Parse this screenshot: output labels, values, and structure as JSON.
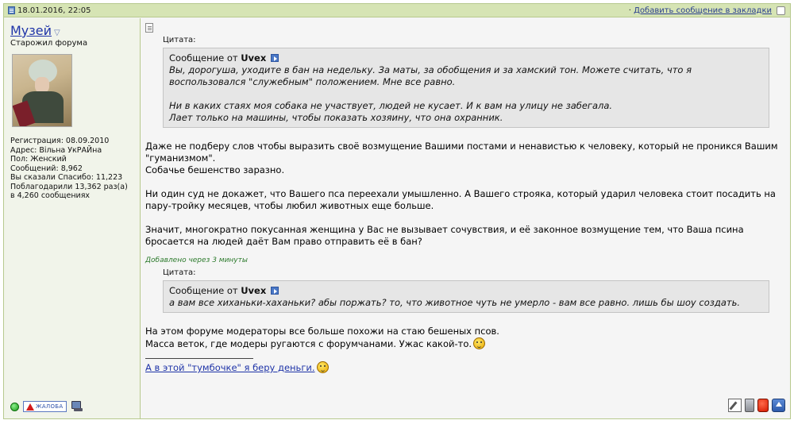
{
  "header": {
    "timestamp": "18.01.2016, 22:05",
    "bookmark_link": "Добавить сообщение в закладки",
    "bookmark_prefix": "·"
  },
  "user": {
    "name": "Музей",
    "dropdown_glyph": "▽",
    "title": "Старожил форума",
    "stats": [
      "Регистрация: 08.09.2010",
      "Адрес: Вільна УкРАЙна",
      "Пол: Женский",
      "Сообщений: 8,962",
      "Вы сказали Спасибо: 11,223",
      "Поблагодарили 13,362 раз(а)",
      "в 4,260 сообщениях"
    ],
    "report_label": "ЖАЛОБА"
  },
  "post": {
    "quote1": {
      "label": "Цитата:",
      "header_prefix": "Сообщение от ",
      "author": "Uvex",
      "lines": [
        "Вы, дорогуша, уходите в бан на недельку. За маты, за обобщения и за хамский тон. Можете считать, что я воспользовался \"служебным\" положением. Мне все равно.",
        "",
        "Ни в каких стаях моя собака не участвует, людей не кусает. И к вам на улицу не забегала.",
        "Лает только на машины, чтобы показать хозяину, что она охранник."
      ]
    },
    "paragraphs1": [
      "Даже не подберу слов чтобы выразить своё возмущение Вашими постами и ненавистью к человеку, который не проникся Вашим \"гуманизмом\".",
      "Собачье бешенство заразно.",
      "",
      "Ни один суд не докажет, что Вашего пса переехали умышленно. А Вашего строяка, который ударил человека стоит посадить на пару-тройку месяцев, чтобы любил животных еще больше.",
      "",
      "Значит, многократно покусанная женщина у Вас не вызывает сочувствия, и её законное возмущение тем, что Ваша псина бросается на людей даёт Вам право отправить её в бан?"
    ],
    "added_note": "Добавлено через 3 минуты",
    "quote2": {
      "label": "Цитата:",
      "header_prefix": "Сообщение от ",
      "author": "Uvex",
      "text": "а вам все хиханьки-хаханьки? абы поржать? то, что животное чуть не умерло - вам все равно. лишь бы шоу создать."
    },
    "paragraphs2": [
      "На этом форуме модераторы все больше похожи на стаю бешеных псов.",
      "Масса веток, где модеры ругаются с форумчанами. Ужас какой-то."
    ],
    "signature": "А в этой \"тумбочке\" я беру деньги."
  }
}
